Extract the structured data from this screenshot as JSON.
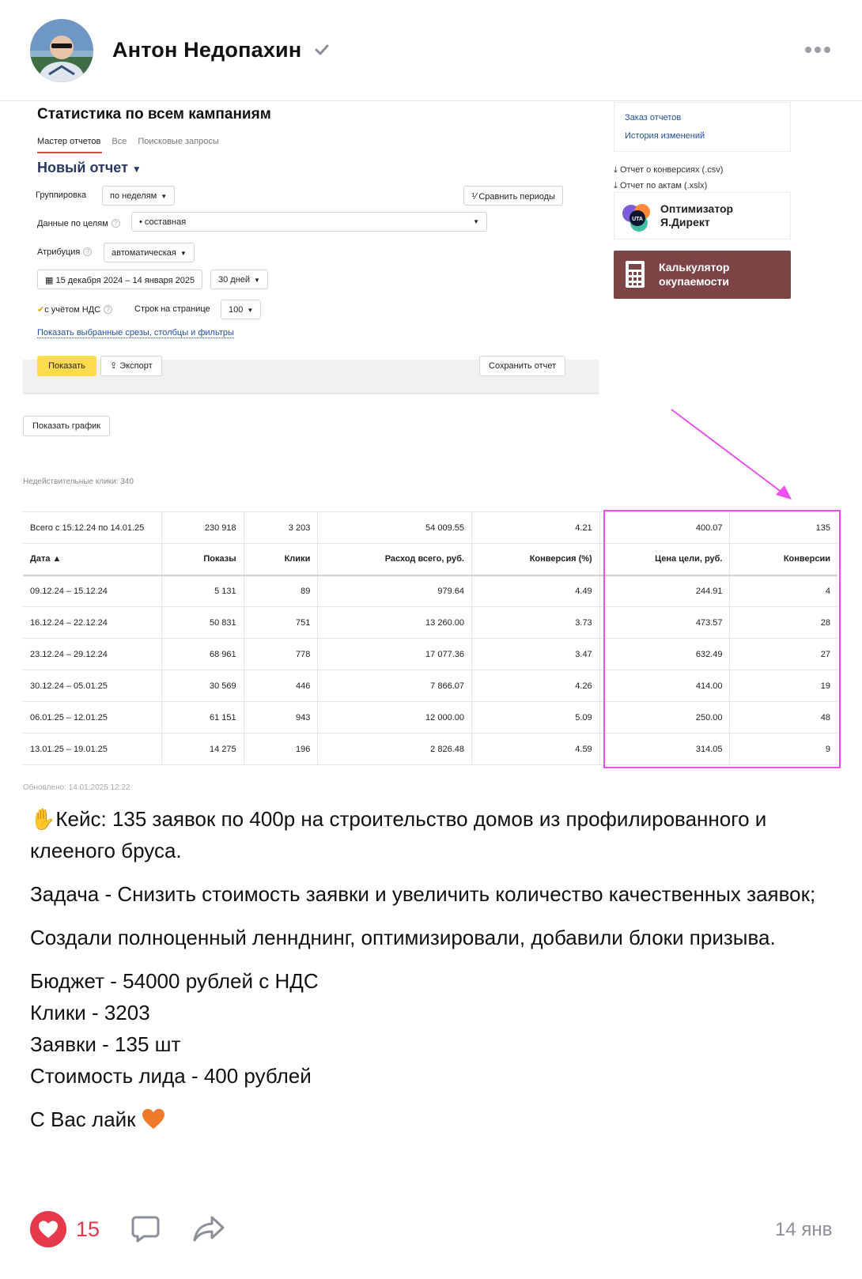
{
  "post": {
    "author": "Антон Недопахин",
    "date": "14 янв",
    "likes": "15",
    "text": {
      "p1": "Кейс: 135 заявок по 400р на строительство домов из профилированного и клееного бруса.",
      "p2": "Задача - Снизить стоимость заявки и увеличить количество качественных заявок;",
      "p3": "Создали полноценный леннднинг, оптимизировали, добавили блоки призыва.",
      "p4": "Бюджет - 54000 рублей с НДС\nКлики - 3203\nЗаявки - 135 шт\nСтоимость лида - 400 рублей",
      "p5": "С Вас лайк"
    }
  },
  "report": {
    "title": "Статистика по всем кампаниям",
    "tabs": [
      "Мастер отчетов",
      "Все",
      "Поисковые запросы"
    ],
    "new_report": "Новый отчет",
    "grouping_label": "Группировка",
    "grouping_value": "по неделям",
    "compare_button": "Сравнить периоды",
    "goals_label": "Данные по целям",
    "goals_value": "• составная",
    "attribution_label": "Атрибуция",
    "attribution_value": "автоматическая",
    "date_range": "15 декабря 2024 – 14 января 2025",
    "period": "30 дней",
    "vat_label": "с учётом НДС",
    "rows_label": "Строк на странице",
    "rows_value": "100",
    "show_filters_link": "Показать выбранные срезы, столбцы и фильтры",
    "show_button": "Показать",
    "export_button": "Экспорт",
    "save_button": "Сохранить отчет",
    "show_chart_button": "Показать график",
    "invalid_clicks": "Недействительные клики: 340",
    "updated": "Обновлено: 14.01.2025 12:22"
  },
  "sidebar": {
    "order_reports": "Заказ отчетов",
    "history": "История изменений",
    "conv_report": "Отчет о конверсиях (.csv)",
    "acts_report": "Отчет по актам (.xslx)",
    "uta_badge": "UTA",
    "optimizer": "Оптимизатор\nЯ.Директ",
    "calculator": "Калькулятор\nокупаемости"
  },
  "table": {
    "total": [
      "Всего с 15.12.24 по 14.01.25",
      "230 918",
      "3 203",
      "54 009.55",
      "4.21",
      "400.07",
      "135"
    ],
    "headers": [
      "Дата ▲",
      "Показы",
      "Клики",
      "Расход всего, руб.",
      "Конверсия (%)",
      "Цена цели, руб.",
      "Конверсии"
    ],
    "rows": [
      [
        "09.12.24 – 15.12.24",
        "5 131",
        "89",
        "979.64",
        "4.49",
        "244.91",
        "4"
      ],
      [
        "16.12.24 – 22.12.24",
        "50 831",
        "751",
        "13 260.00",
        "3.73",
        "473.57",
        "28"
      ],
      [
        "23.12.24 – 29.12.24",
        "68 961",
        "778",
        "17 077.36",
        "3.47",
        "632.49",
        "27"
      ],
      [
        "30.12.24 – 05.01.25",
        "30 569",
        "446",
        "7 866.07",
        "4.26",
        "414.00",
        "19"
      ],
      [
        "06.01.25 – 12.01.25",
        "61 151",
        "943",
        "12 000.00",
        "5.09",
        "250.00",
        "48"
      ],
      [
        "13.01.25 – 19.01.25",
        "14 275",
        "196",
        "2 826.48",
        "4.59",
        "314.05",
        "9"
      ]
    ]
  },
  "colors": {
    "like": "#e6394a",
    "highlight": "#f04ff0",
    "calc_bg": "#7d4446",
    "button_yellow": "#ffdb4d"
  },
  "icons": [
    "verified-icon",
    "more-icon",
    "download-icon",
    "calendar-icon",
    "calculator-icon",
    "heart-icon",
    "comment-icon",
    "share-icon",
    "wave-hand-icon",
    "orange-heart-icon"
  ]
}
